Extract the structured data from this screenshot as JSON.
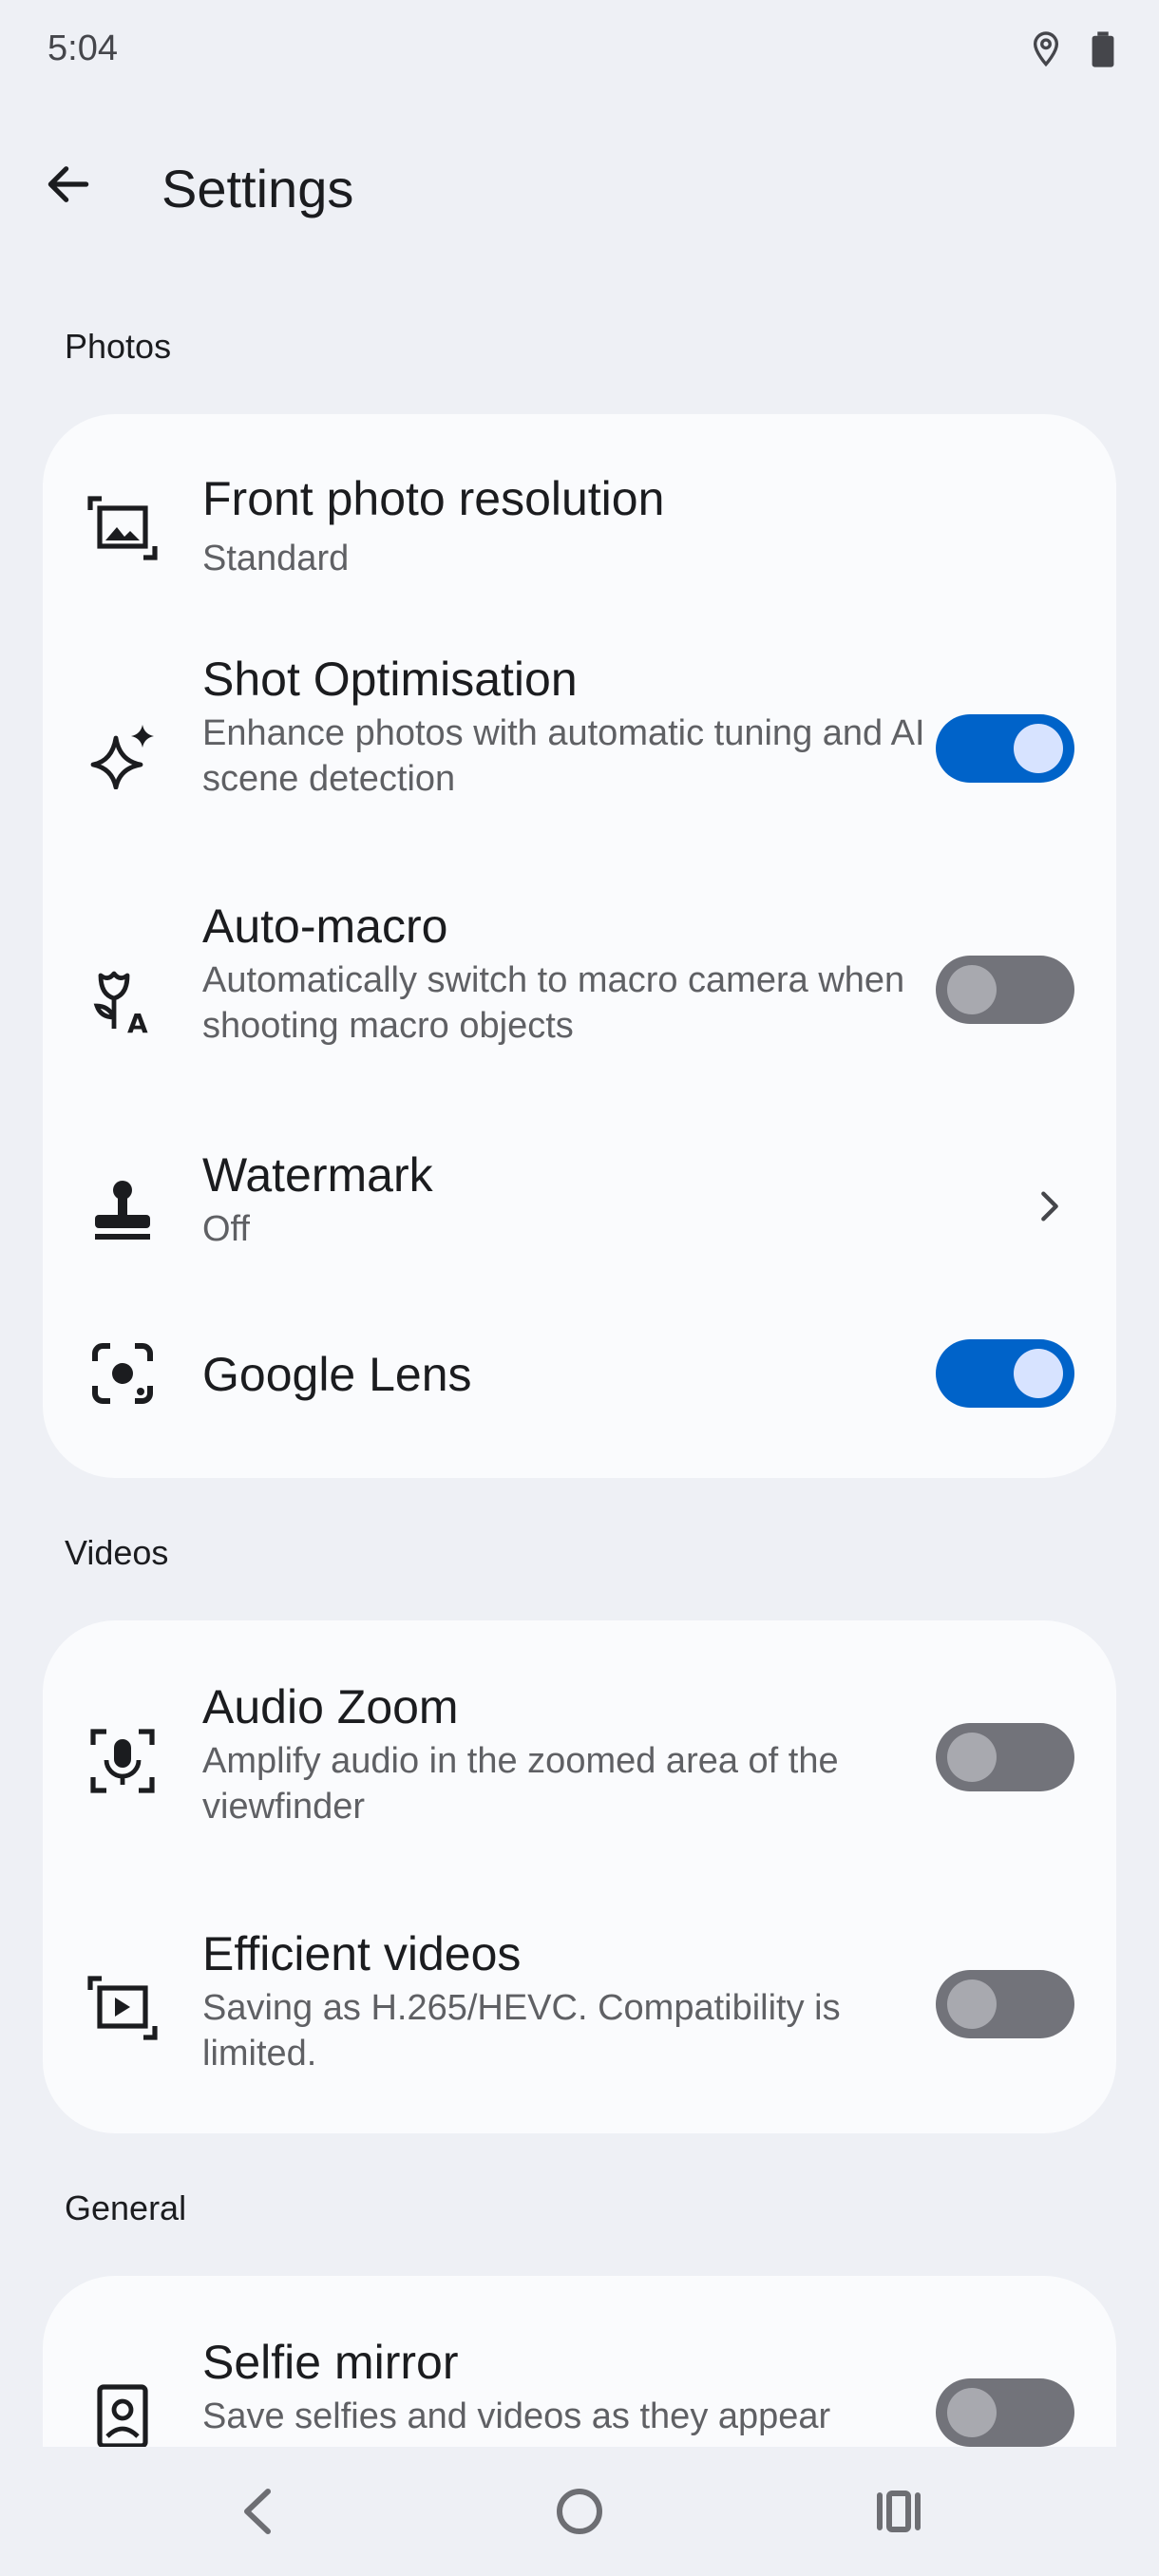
{
  "status_bar": {
    "time": "5:04",
    "icons": [
      "location-icon",
      "battery-icon"
    ]
  },
  "app_bar": {
    "title": "Settings",
    "back_icon": "arrow-back-icon"
  },
  "sections": {
    "photos": {
      "header": "Photos",
      "front_photo_resolution": {
        "title": "Front photo resolution",
        "value": "Standard",
        "icon": "image-frame-icon"
      },
      "shot_optimisation": {
        "title": "Shot Optimisation",
        "subtitle": "Enhance photos with automatic tuning and AI scene detection",
        "enabled": true,
        "icon": "sparkle-icon"
      },
      "auto_macro": {
        "title": "Auto-macro",
        "subtitle": "Automatically switch to macro camera when shooting macro objects",
        "enabled": false,
        "icon": "flower-auto-icon"
      },
      "watermark": {
        "title": "Watermark",
        "value": "Off",
        "icon": "stamp-icon"
      },
      "google_lens": {
        "title": "Google Lens",
        "enabled": true,
        "icon": "lens-icon"
      }
    },
    "videos": {
      "header": "Videos",
      "audio_zoom": {
        "title": "Audio Zoom",
        "subtitle": "Amplify audio in the zoomed area of the viewfinder",
        "enabled": false,
        "icon": "mic-focus-icon"
      },
      "efficient_videos": {
        "title": "Efficient videos",
        "subtitle": "Saving as H.265/HEVC. Compatibility is limited.",
        "enabled": false,
        "icon": "video-frame-icon"
      }
    },
    "general": {
      "header": "General",
      "selfie_mirror": {
        "title": "Selfie mirror",
        "subtitle": "Save selfies and videos as they appear",
        "enabled": false,
        "icon": "portrait-icon"
      }
    }
  },
  "nav_bar": {
    "buttons": [
      "nav-back-icon",
      "nav-home-icon",
      "nav-recents-icon"
    ]
  },
  "colors": {
    "background": "#eef0f5",
    "card": "#fafbfd",
    "toggle_on": "#0063c9",
    "toggle_off": "#72737a",
    "text_primary": "#1b1c1f",
    "text_secondary": "#5f6064"
  }
}
